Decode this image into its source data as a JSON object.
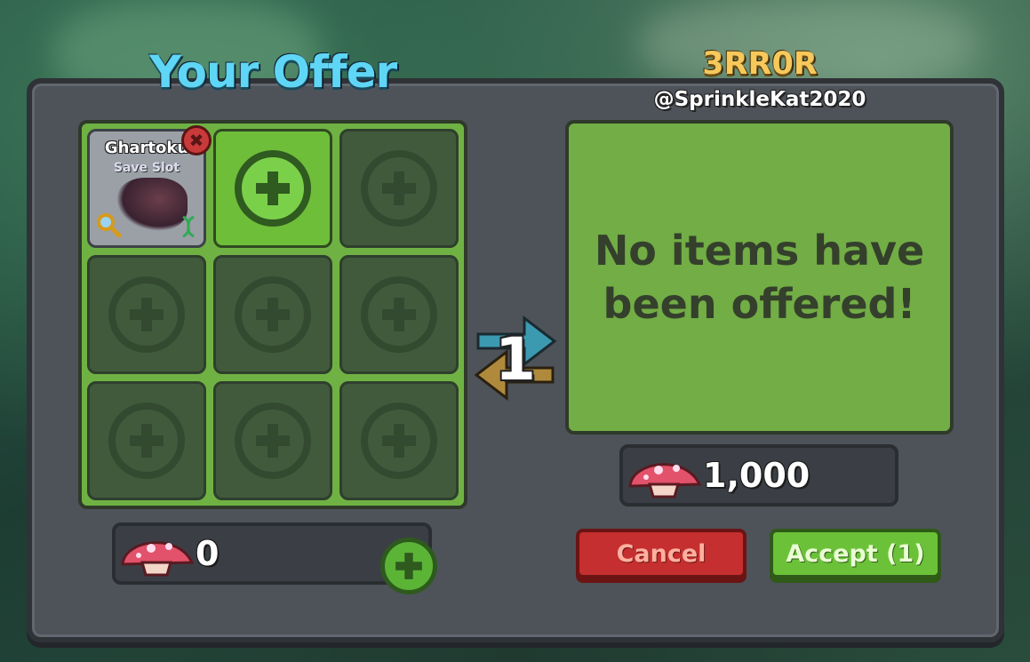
{
  "your_offer": {
    "title": "Your Offer",
    "items": [
      {
        "name": "Ghartoku",
        "subtitle": "Save Slot"
      }
    ],
    "currency_amount": "0"
  },
  "partner": {
    "display_name": "3RR0R",
    "username": "@SprinkleKat2020",
    "empty_message": "No items have been offered!",
    "currency_amount": "1,000"
  },
  "swap": {
    "count": "1"
  },
  "buttons": {
    "cancel_label": "Cancel",
    "accept_label": "Accept (1)"
  },
  "colors": {
    "offer_green": "#6fb243",
    "cancel_red": "#c52f2f",
    "accept_green": "#6bc239",
    "title_blue": "#5fd6f5",
    "partner_gold": "#f7c85c"
  },
  "icons": [
    "close-icon",
    "magnify-icon",
    "dna-icon",
    "plus-icon",
    "mushroom-currency-icon",
    "swap-arrows-icon"
  ]
}
